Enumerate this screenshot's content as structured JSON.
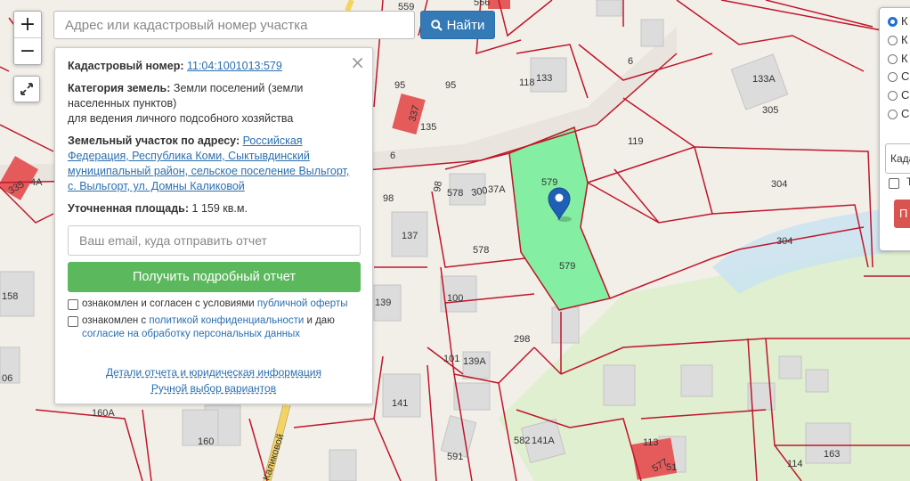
{
  "search": {
    "placeholder": "Адрес или кадастровый номер участка",
    "button": "Найти"
  },
  "zoom": {
    "plus": "+",
    "minus": "−"
  },
  "panel": {
    "cadastral_label": "Кадастровый номер:",
    "cadastral_value": "11:04:1001013:579",
    "category_label": "Категория земель:",
    "category_value": "Земли поселений (земли населенных пунктов)",
    "category_use": "для ведения личного подсобного хозяйства",
    "address_label": "Земельный участок по адресу:",
    "address_value": "Российская Федерация, Республика Коми, Сыктывдинский муниципальный район, сельское поселение Выльгорт, с. Выльгорт, ул. Домны Каликовой",
    "area_label": "Уточненная площадь:",
    "area_value": "1 159 кв.м.",
    "email_placeholder": "Ваш email, куда отправить отчет",
    "report_button": "Получить подробный отчет",
    "consent1_text": "ознакомлен и согласен с условиями ",
    "consent1_link": "публичной оферты",
    "consent2_text": "ознакомлен с ",
    "consent2_link": "политикой конфиденциальности",
    "consent2_mid": " и даю ",
    "consent2_link2": "согласие на обработку персональных данных",
    "details_link": "Детали отчета и юридическая информация",
    "manual_link": "Ручной выбор вариантов",
    "close_icon": "×"
  },
  "layers": {
    "options": [
      "К",
      "К",
      "К",
      "С",
      "С",
      "С"
    ],
    "selected_index": 0,
    "select_value": "Када",
    "checkbox_label": "Т",
    "button_label": "П"
  },
  "map": {
    "parcel_labels": [
      "559",
      "566",
      "6",
      "95",
      "95",
      "118",
      "133",
      "133А",
      "305",
      "337",
      "135",
      "119",
      "6",
      "335",
      "4А",
      "98",
      "98",
      "578",
      "300",
      "37А",
      "579",
      "579",
      "578",
      "304",
      "304",
      "137",
      "158",
      "139",
      "100",
      "298",
      "101",
      "139А",
      "06",
      "141",
      "160А",
      "160",
      "582",
      "141А",
      "113",
      "577",
      "51",
      "591",
      "114",
      "163"
    ],
    "street_label": "Каликовой",
    "selected_parcel_color": "#7ff0a0",
    "boundary_color": "#c0162b",
    "building_color": "#dddddd",
    "highlight_building_color": "#e55a5a"
  }
}
